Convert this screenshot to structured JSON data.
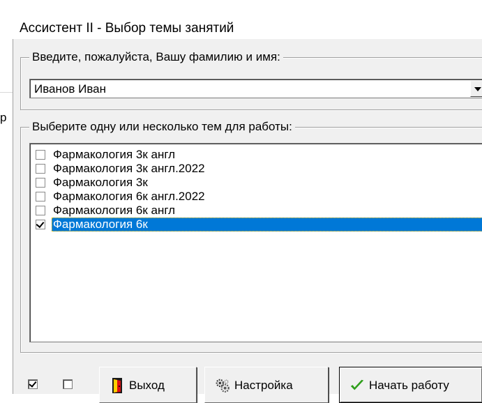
{
  "window": {
    "title": "Ассистент II - Выбор темы занятий"
  },
  "background": {
    "partial_glyph": "р"
  },
  "name_group": {
    "legend": "Введите, пожалуйста, Вашу фамилию и имя:",
    "combo_value": "Иванов Иван"
  },
  "topics_group": {
    "legend": "Выберите одну или несколько тем для работы:",
    "items": [
      {
        "label": "Фармакология 3к англ",
        "checked": false,
        "selected": false
      },
      {
        "label": "Фармакология 3к англ.2022",
        "checked": false,
        "selected": false
      },
      {
        "label": "Фармакология 3к",
        "checked": false,
        "selected": false
      },
      {
        "label": "Фармакология 6к англ.2022",
        "checked": false,
        "selected": false
      },
      {
        "label": "Фармакология 6к англ",
        "checked": false,
        "selected": false
      },
      {
        "label": "Фармакология 6к",
        "checked": true,
        "selected": true
      }
    ]
  },
  "bottom_bar": {
    "check_all_checked": true,
    "uncheck_all_checked": false,
    "exit_label": "Выход",
    "settings_label": "Настройка",
    "start_label": "Начать работу"
  },
  "colors": {
    "selection": "#0078d7",
    "face": "#f0f0f0",
    "start_check_icon": "#2e9e1a"
  },
  "icons": {
    "exit": "exit-door-icon",
    "settings": "settings-gears-icon",
    "start": "checkmark-icon",
    "combo_arrow": "chevron-down-icon"
  }
}
